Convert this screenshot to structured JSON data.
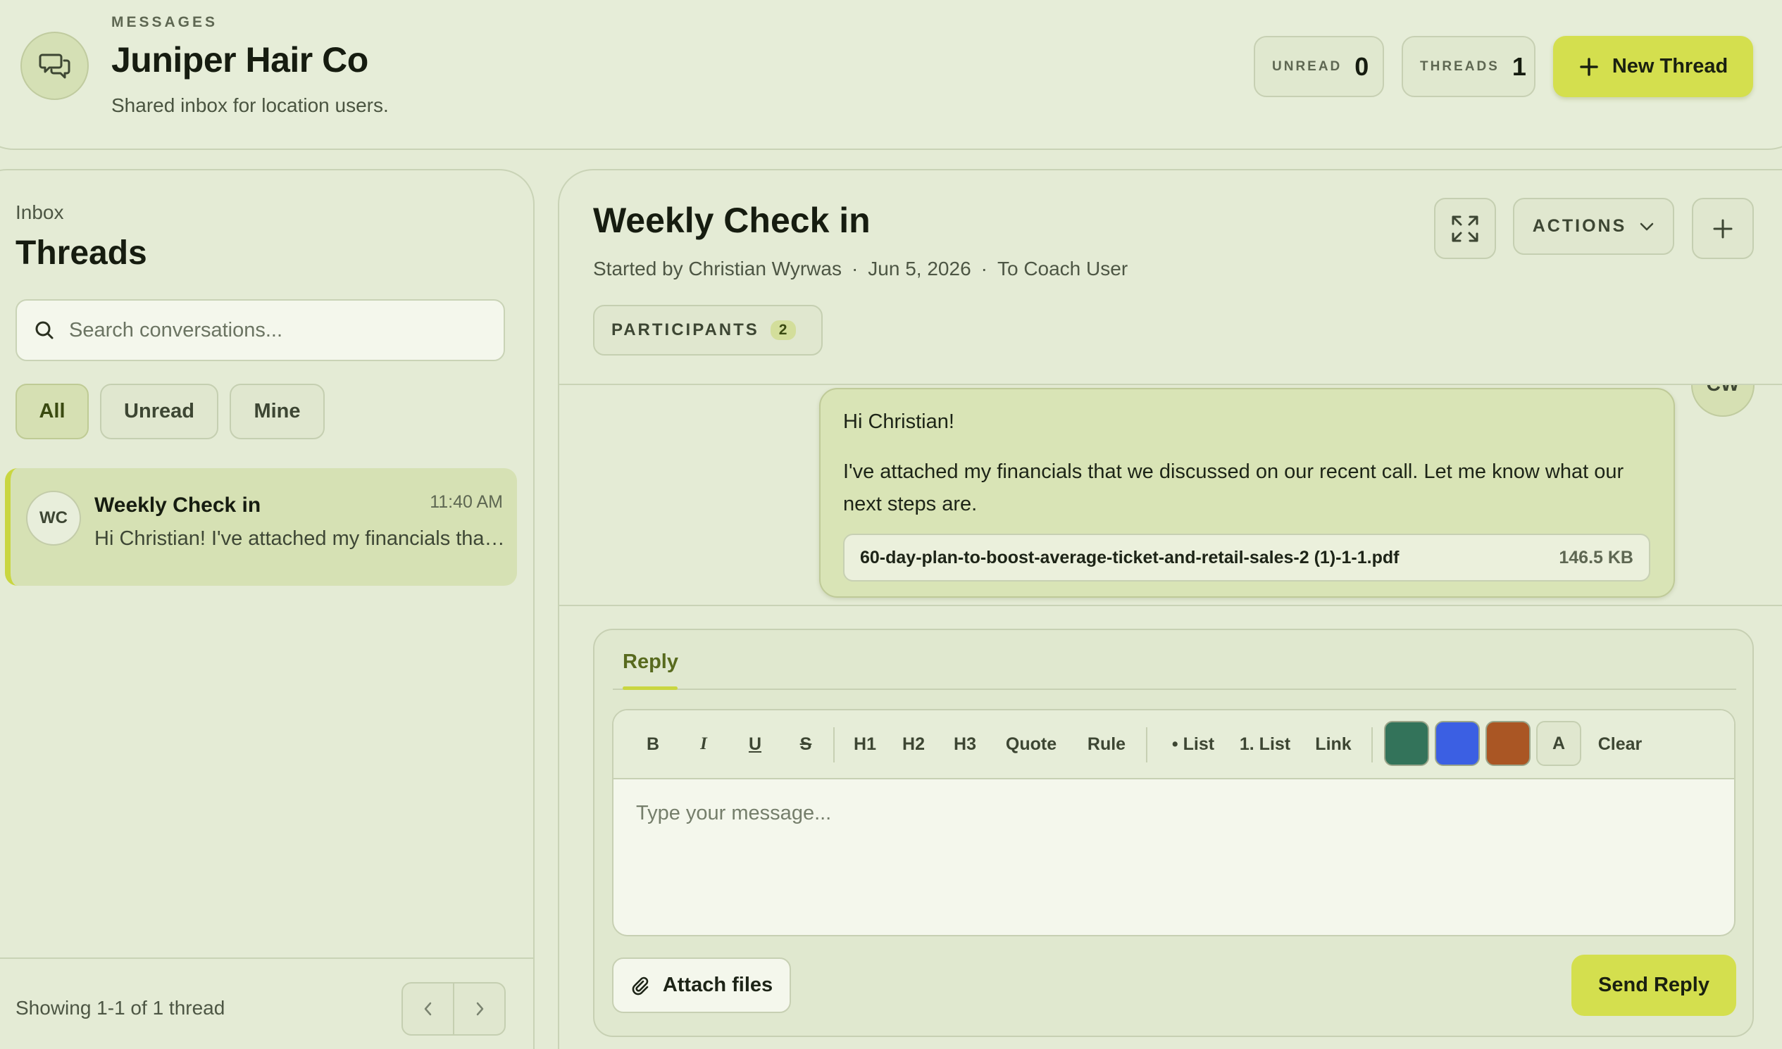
{
  "header": {
    "eyebrow": "MESSAGES",
    "title": "Juniper Hair Co",
    "subtitle": "Shared inbox for location users.",
    "stats": [
      {
        "label": "UNREAD",
        "value": "0"
      },
      {
        "label": "THREADS",
        "value": "1"
      }
    ],
    "new_thread_label": "New Thread"
  },
  "sidebar": {
    "section_label": "Inbox",
    "title": "Threads",
    "search_placeholder": "Search conversations...",
    "filters": [
      {
        "label": "All",
        "active": true
      },
      {
        "label": "Unread",
        "active": false
      },
      {
        "label": "Mine",
        "active": false
      }
    ],
    "threads": [
      {
        "initials": "WC",
        "name": "Weekly Check in",
        "time": "11:40 AM",
        "preview": "Hi Christian! I've attached my financials that we discussed on our recent call."
      }
    ],
    "pagination_text": "Showing 1-1 of 1 thread"
  },
  "thread": {
    "title": "Weekly Check in",
    "started_by": "Started by Christian Wyrwas",
    "date": "Jun 5, 2026",
    "recipient": "To Coach User",
    "participants_label": "PARTICIPANTS",
    "participants_count": "2",
    "actions_label": "ACTIONS",
    "message": {
      "avatar_initials": "CW",
      "greeting": "Hi Christian!",
      "body": "I've attached my financials that we discussed on our recent call. Let me know what our next steps are.",
      "attachment": {
        "filename": "60-day-plan-to-boost-average-ticket-and-retail-sales-2 (1)-1-1.pdf",
        "size": "146.5 KB"
      }
    }
  },
  "reply": {
    "tab_label": "Reply",
    "toolbar": {
      "bold": "B",
      "italic": "I",
      "underline": "U",
      "strike": "S",
      "h1": "H1",
      "h2": "H2",
      "h3": "H3",
      "quote": "Quote",
      "rule": "Rule",
      "bullet_list": "• List",
      "number_list": "1. List",
      "link": "Link",
      "color_reset": "A",
      "clear": "Clear"
    },
    "swatch_colors": [
      "#33735a",
      "#3b5fe3",
      "#aa5624"
    ],
    "placeholder": "Type your message...",
    "attach_label": "Attach files",
    "send_label": "Send Reply"
  },
  "colors": {
    "background": "#e4ebd5",
    "accent": "#d4df4e"
  }
}
